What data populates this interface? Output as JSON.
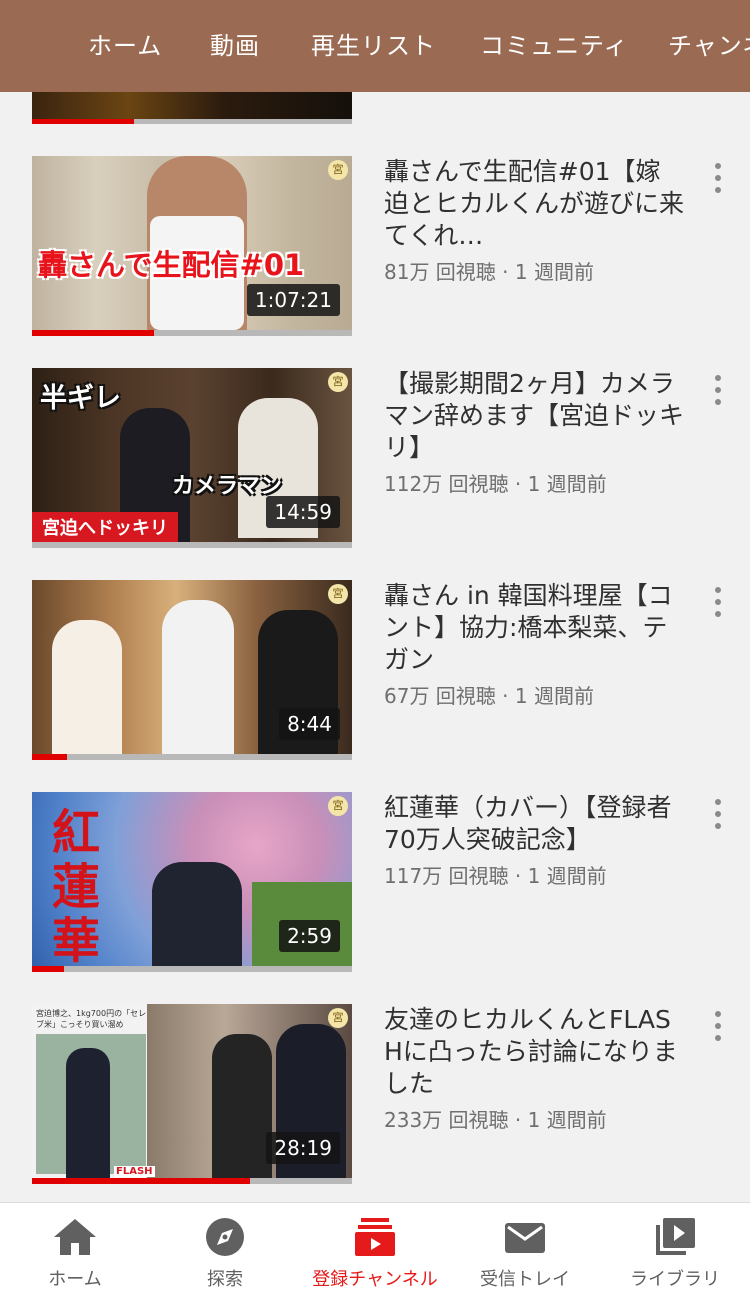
{
  "top_tabs": [
    {
      "label": "ホーム"
    },
    {
      "label": "動画"
    },
    {
      "label": "再生リスト"
    },
    {
      "label": "コミュニティ"
    },
    {
      "label": "チャンネル"
    }
  ],
  "partial_video": {
    "watch_progress": 0.32
  },
  "videos": [
    {
      "title": "轟さんで生配信#01【嫁迫とヒカルくんが遊びに来てくれ…",
      "meta": "81万 回視聴 · 1 週間前",
      "duration": "1:07:21",
      "overlay": "轟さんで生配信#01",
      "badge": "宮",
      "watch_progress": 0.38
    },
    {
      "title": "【撮影期間2ヶ月】カメラマン辞めます【宮迫ドッキリ】",
      "meta": "112万 回視聴 · 1 週間前",
      "duration": "14:59",
      "overlay_a": "半ギレ",
      "overlay_b": "カメラマン",
      "banner": "宮迫へドッキリ",
      "badge": "宮",
      "watch_progress": 0.0
    },
    {
      "title": "轟さん in 韓国料理屋【コント】協力:橋本梨菜、テガン",
      "meta": "67万 回視聴 · 1 週間前",
      "duration": "8:44",
      "badge": "宮",
      "watch_progress": 0.11
    },
    {
      "title": "紅蓮華（カバー）【登録者70万人突破記念】",
      "meta": "117万 回視聴 · 1 週間前",
      "duration": "2:59",
      "overlay": "紅蓮華",
      "badge": "宮",
      "watch_progress": 0.1
    },
    {
      "title": "友達のヒカルくんとFLASHに凸ったら討論になりました",
      "meta": "233万 回視聴 · 1 週間前",
      "duration": "28:19",
      "caption": "宮迫博之、1kg700円の「セレブ米」こっそり買い溜め",
      "flash": "FLASH",
      "badge": "宮",
      "watch_progress": 0.68
    }
  ],
  "bottom_nav": [
    {
      "label": "ホーム",
      "icon": "home-icon",
      "active": false
    },
    {
      "label": "探索",
      "icon": "explore-icon",
      "active": false
    },
    {
      "label": "登録チャンネル",
      "icon": "subscriptions-icon",
      "active": true
    },
    {
      "label": "受信トレイ",
      "icon": "inbox-icon",
      "active": false
    },
    {
      "label": "ライブラリ",
      "icon": "library-icon",
      "active": false
    }
  ],
  "colors": {
    "topbar": "#9a6a52",
    "active": "#e51b1b",
    "progress": "#e10000"
  }
}
